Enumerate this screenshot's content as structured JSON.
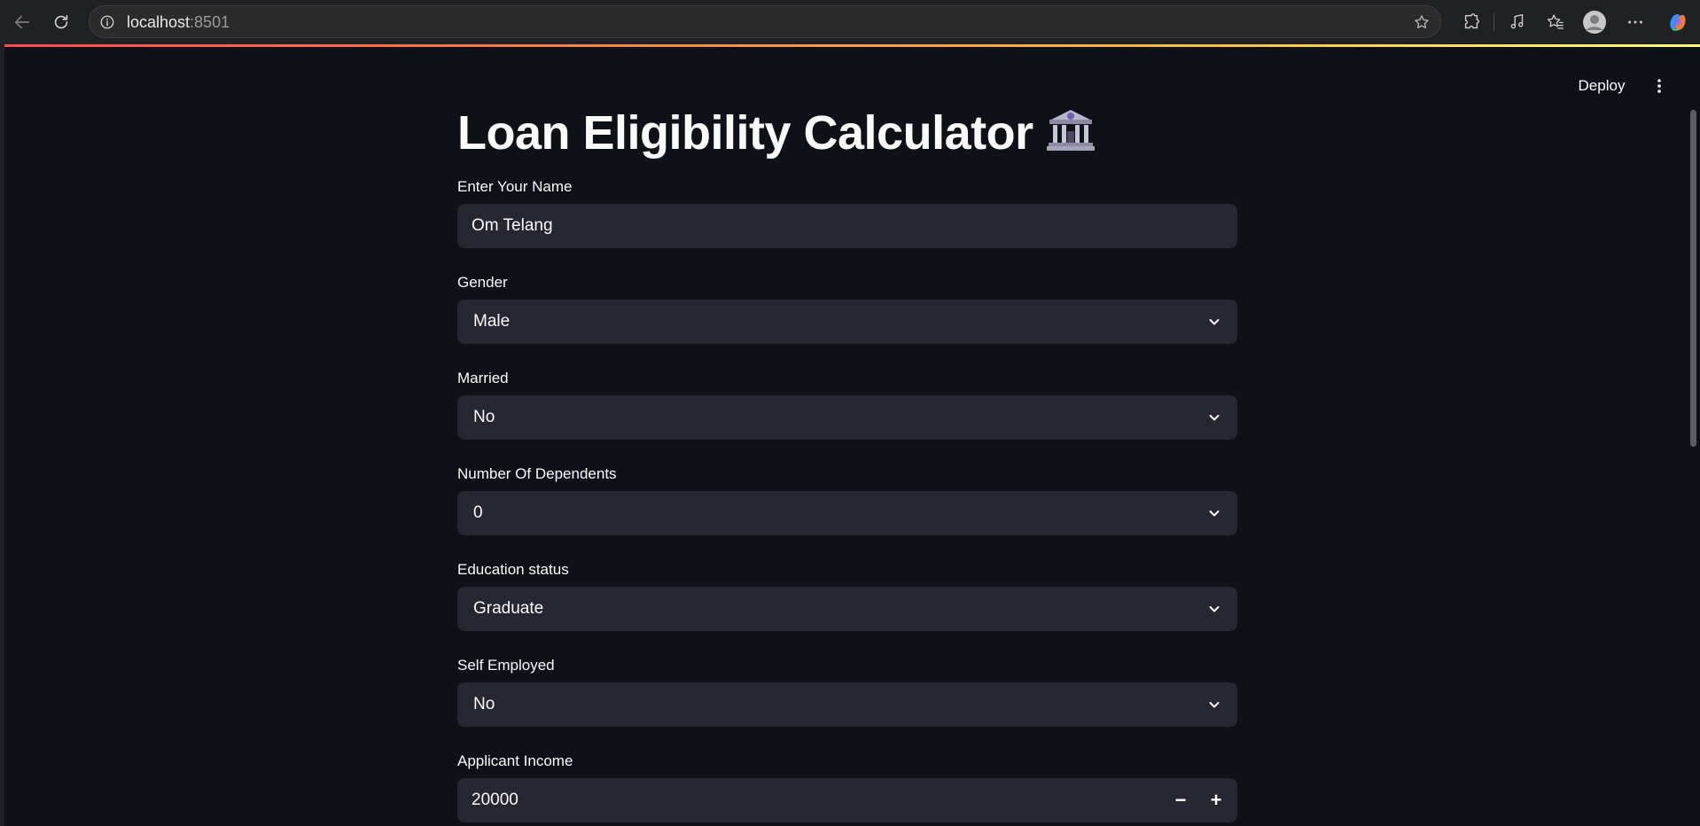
{
  "browser": {
    "url_host": "localhost",
    "url_port": ":8501"
  },
  "app": {
    "deploy_label": "Deploy",
    "title": "Loan Eligibility Calculator",
    "title_icon": "bank-icon"
  },
  "form": {
    "name": {
      "label": "Enter Your Name",
      "value": "Om Telang"
    },
    "gender": {
      "label": "Gender",
      "value": "Male"
    },
    "married": {
      "label": "Married",
      "value": "No"
    },
    "dependents": {
      "label": "Number Of Dependents",
      "value": "0"
    },
    "education": {
      "label": "Education status",
      "value": "Graduate"
    },
    "self_employed": {
      "label": "Self Employed",
      "value": "No"
    },
    "applicant_income": {
      "label": "Applicant Income",
      "value": "20000",
      "minus": "−",
      "plus": "+"
    }
  },
  "colors": {
    "app_bg": "#0e1117",
    "widget_bg": "#262730",
    "text": "#fafafa",
    "accent": "#ff4b4b"
  }
}
